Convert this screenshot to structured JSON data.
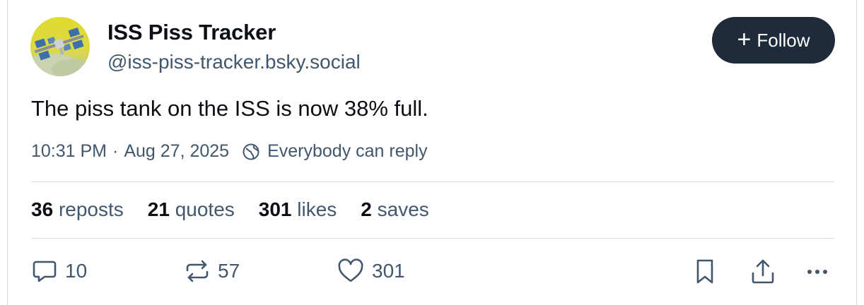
{
  "author": {
    "display_name": "ISS Piss Tracker",
    "handle": "@iss-piss-tracker.bsky.social",
    "avatar_icon": "iss-space-station-icon"
  },
  "follow_button": {
    "label": "Follow",
    "icon": "plus-icon"
  },
  "post": {
    "text": "The piss tank on the ISS is now 38% full.",
    "time": "10:31 PM",
    "separator": "·",
    "date": "Aug 27, 2025",
    "reply_setting": "Everybody can reply",
    "reply_setting_icon": "globe-icon"
  },
  "stats": [
    {
      "count": "36",
      "label": "reposts"
    },
    {
      "count": "21",
      "label": "quotes"
    },
    {
      "count": "301",
      "label": "likes"
    },
    {
      "count": "2",
      "label": "saves"
    }
  ],
  "actions": {
    "reply": {
      "count": "10",
      "icon": "reply-bubble-icon"
    },
    "repost": {
      "count": "57",
      "icon": "repost-icon"
    },
    "like": {
      "count": "301",
      "icon": "heart-icon"
    },
    "bookmark": {
      "icon": "bookmark-icon"
    },
    "share": {
      "icon": "share-icon"
    },
    "more": {
      "icon": "more-dots-icon"
    }
  },
  "colors": {
    "text_primary": "#0b0f14",
    "text_secondary": "#42576c",
    "follow_button_bg": "#1f2b3a",
    "divider": "#d4dbe2"
  }
}
